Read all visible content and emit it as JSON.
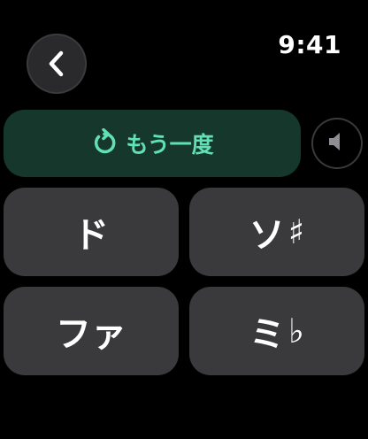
{
  "status_bar": {
    "time": "9:41"
  },
  "navigation": {
    "back_icon": "chevron-left-icon"
  },
  "replay": {
    "icon": "replay-arrow-icon",
    "label": "もう一度"
  },
  "speaker": {
    "icon": "speaker-icon"
  },
  "answers": [
    {
      "note": "ド",
      "accidental": ""
    },
    {
      "note": "ソ",
      "accidental": "♯"
    },
    {
      "note": "ファ",
      "accidental": ""
    },
    {
      "note": "ミ",
      "accidental": "♭"
    }
  ],
  "colors": {
    "background": "#000000",
    "button": "#3a3a3c",
    "replay_bg": "#16382c",
    "accent": "#5fe0b5"
  }
}
